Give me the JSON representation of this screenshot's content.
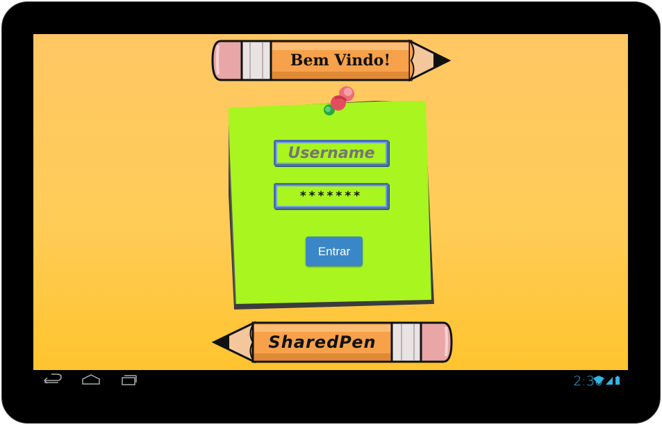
{
  "welcome_banner": {
    "text": "Bem Vindo!"
  },
  "login_form": {
    "username_placeholder": "Username",
    "password_value": "*******",
    "submit_label": "Entrar"
  },
  "brand_banner": {
    "text": "SharedPen"
  },
  "status_bar": {
    "time": "2:30"
  },
  "colors": {
    "background": "#ffc764",
    "sticky_note": "#a9f51f",
    "pencil_body": "#f7a14a",
    "button": "#3a87c7",
    "status_accent": "#33b5e5"
  },
  "icons": {
    "pushpin": "pushpin-icon",
    "back": "back-icon",
    "home": "home-icon",
    "recents": "recents-icon",
    "wifi": "wifi-icon",
    "signal": "signal-icon",
    "battery": "battery-icon"
  }
}
